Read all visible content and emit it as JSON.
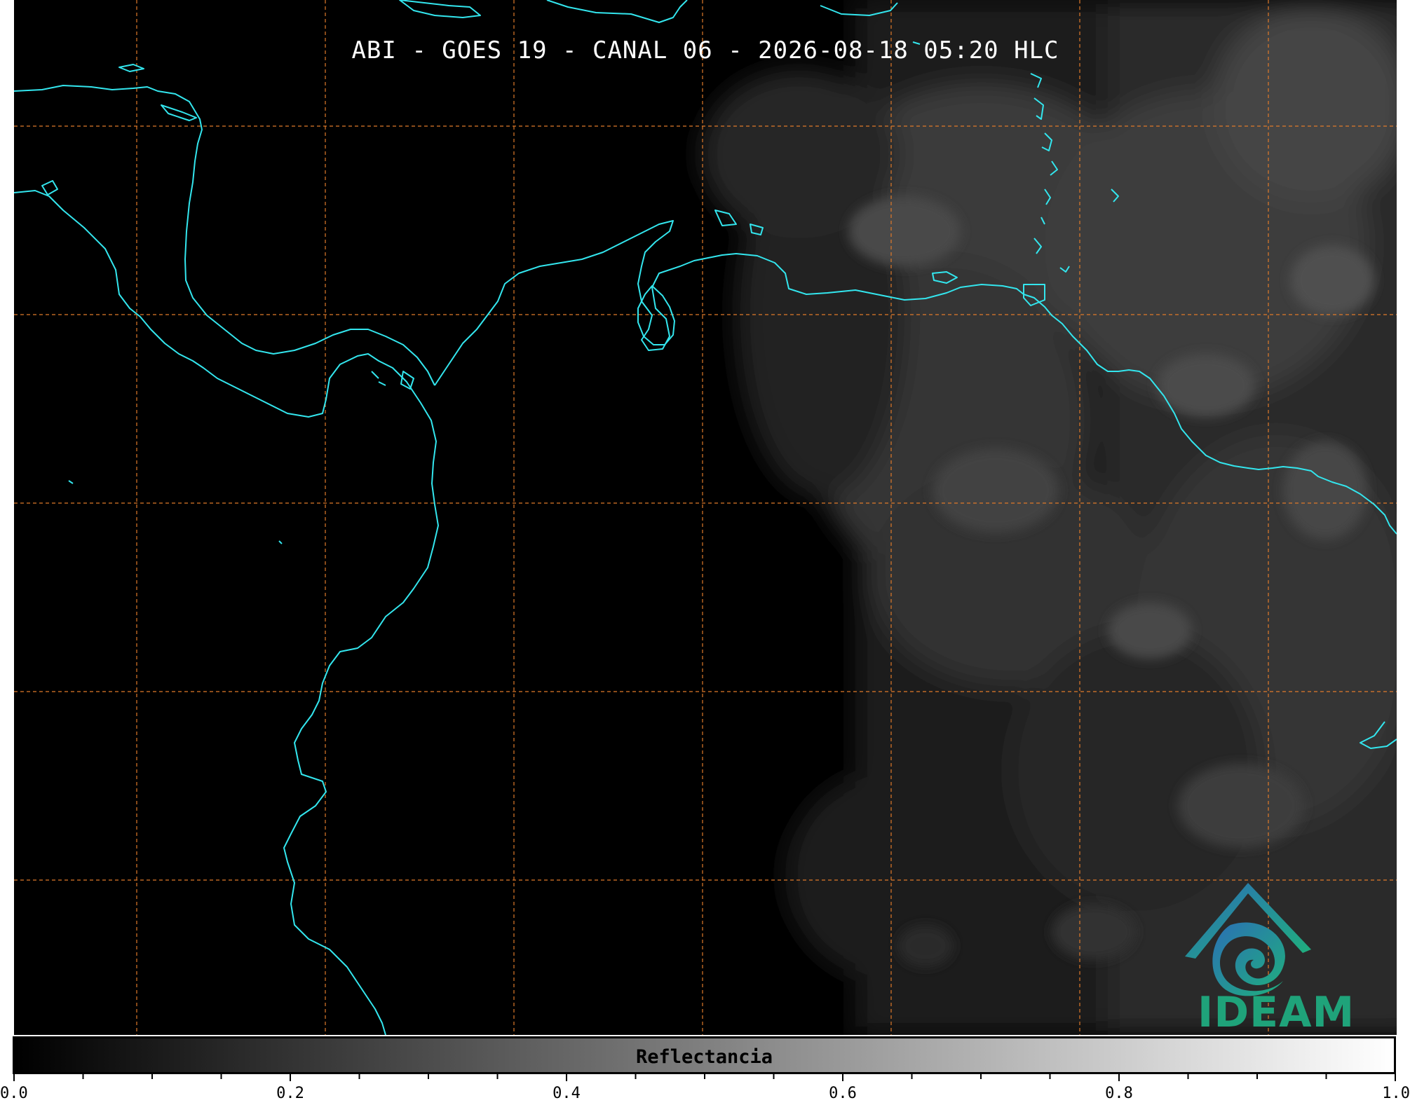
{
  "map": {
    "title": "ABI - GOES 19 - CANAL 06 - 2026-08-18 05:20 HLC",
    "background_color": "#000000",
    "coastline_color": "#33e6ee",
    "gridline_color": "#e07a2a",
    "gridline_style": "dashed",
    "coastline_color_name": "cyan",
    "regions_shown": [
      "Central America",
      "Colombia",
      "Venezuela",
      "Caribbean Sea",
      "Pacific Ocean"
    ]
  },
  "logo": {
    "text": "IDEAM",
    "text_color": "#1fa37a",
    "mark_colors": [
      "#2b6fb5",
      "#1fb07c"
    ]
  },
  "colorbar": {
    "label": "Reflectancia",
    "min": 0.0,
    "max": 1.0,
    "colormap": "gray",
    "tick_labels": [
      "0.0",
      "0.2",
      "0.4",
      "0.6",
      "0.8",
      "1.0"
    ]
  }
}
